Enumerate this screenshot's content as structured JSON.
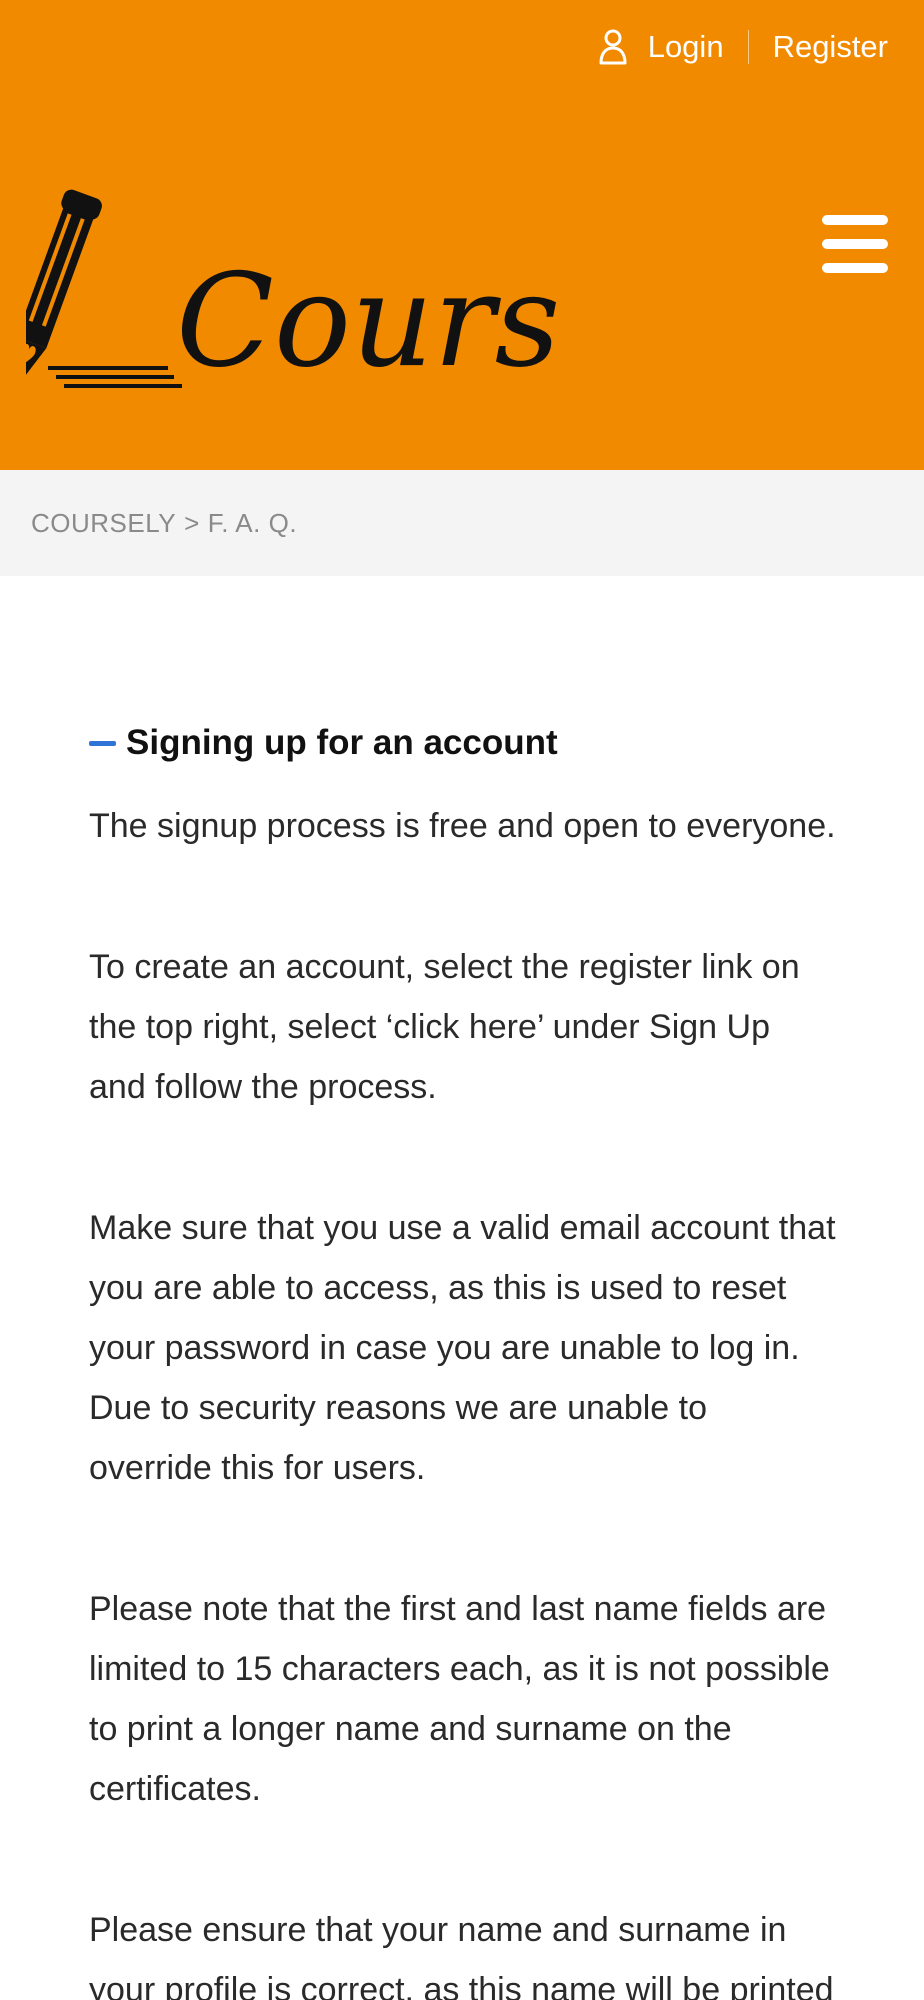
{
  "header": {
    "login_label": "Login",
    "register_label": "Register",
    "brand_text": "Coursely",
    "background_color": "#f28a00",
    "icons": {
      "user": "user-icon",
      "menu": "menu-icon",
      "logo": "pencil-icon"
    }
  },
  "breadcrumb": {
    "home": "COURSELY",
    "separator": ">",
    "current": "F. A. Q."
  },
  "faq": {
    "accent_color": "#2f74d6",
    "section": {
      "title": "Signing up for an account",
      "paragraphs": [
        "The signup process is free and open to everyone.",
        "To create an account, select the register link on the top right, select ‘click here’ under Sign Up and follow the process.",
        "Make sure that you use a valid email account that you are able to access, as this is used to reset your password in case you are unable to log in. Due to security reasons we are unable to override this for users.",
        "Please note that the first and last name fields are limited to 15 characters each, as it is not possible to print a longer name and surname on the certificates.",
        "Please ensure that your name and surname in your profile is correct, as this name will be printed on"
      ]
    }
  }
}
